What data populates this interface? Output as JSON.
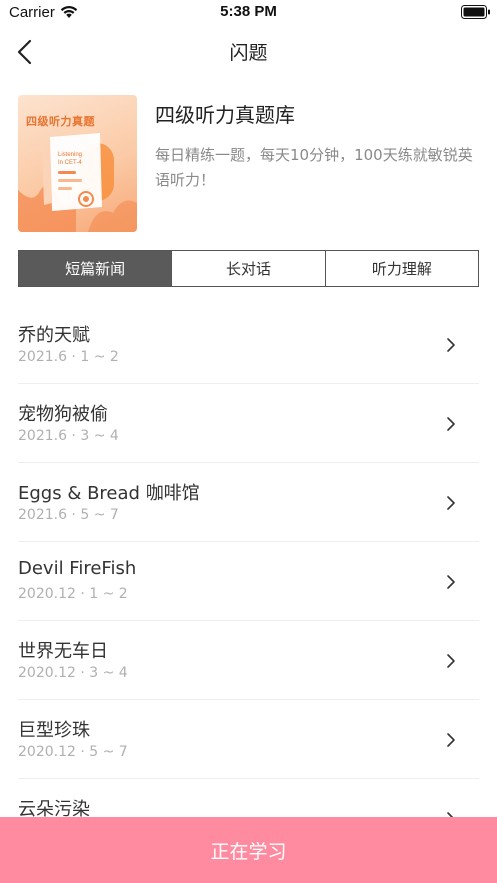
{
  "status": {
    "carrier": "Carrier",
    "time": "5:38 PM"
  },
  "nav": {
    "title": "闪题"
  },
  "header": {
    "cover_title": "四级听力真题",
    "cover_caption_1": "Listening",
    "cover_caption_2": "In CET-4",
    "book_title": "四级听力真题库",
    "description": "每日精练一题，每天10分钟，100天练就敏锐英语听力！"
  },
  "tabs": [
    {
      "label": "短篇新闻",
      "active": true
    },
    {
      "label": "长对话",
      "active": false
    },
    {
      "label": "听力理解",
      "active": false
    }
  ],
  "items": [
    {
      "title": "乔的天赋",
      "sub": "2021.6 · 1 ~ 2"
    },
    {
      "title": "宠物狗被偷",
      "sub": "2021.6 · 3 ~ 4"
    },
    {
      "title": "Eggs & Bread 咖啡馆",
      "sub": "2021.6 · 5 ~ 7"
    },
    {
      "title": "Devil FireFish",
      "sub": "2020.12 · 1 ~ 2"
    },
    {
      "title": "世界无车日",
      "sub": "2020.12 · 3 ~ 4"
    },
    {
      "title": "巨型珍珠",
      "sub": "2020.12 · 5 ~ 7"
    },
    {
      "title": "云朵污染",
      "sub": ""
    }
  ],
  "footer": {
    "button_label": "正在学习"
  },
  "colors": {
    "accent": "#ff8ba0",
    "tab_active": "#5a5a5a",
    "cover_orange": "#f7a877"
  },
  "icons": {
    "back": "chevron-left-icon",
    "row": "chevron-right-icon",
    "wifi": "wifi-icon",
    "battery": "battery-icon"
  }
}
